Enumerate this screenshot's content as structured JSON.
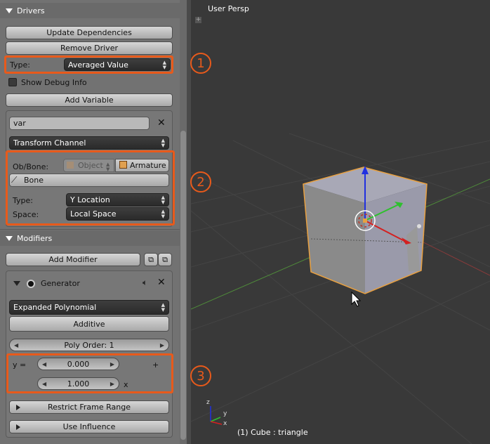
{
  "drivers": {
    "header": "Drivers",
    "update_dependencies": "Update Dependencies",
    "remove_driver": "Remove Driver",
    "type_label": "Type:",
    "type_value": "Averaged Value",
    "show_debug": "Show Debug Info",
    "add_variable": "Add Variable",
    "var_name": "var",
    "var_type": "Transform Channel",
    "ob_bone_label": "Ob/Bone:",
    "object_value": "Object",
    "armature_value": "Armature",
    "bone_value": "Bone",
    "channel_type_label": "Type:",
    "channel_type_value": "Y Location",
    "space_label": "Space:",
    "space_value": "Local Space"
  },
  "modifiers": {
    "header": "Modifiers",
    "add_modifier": "Add Modifier",
    "generator_name": "Generator",
    "mode": "Expanded Polynomial",
    "additive": "Additive",
    "poly_order": "Poly Order: 1",
    "y_equals": "y =",
    "coef0": "0.000",
    "plus": "+",
    "coef1": "1.000",
    "x_label": "x",
    "restrict_frame_range": "Restrict Frame Range",
    "use_influence": "Use Influence"
  },
  "annotations": [
    "1",
    "2",
    "3"
  ],
  "viewport": {
    "view_name": "User Persp",
    "object_info": "(1) Cube : triangle",
    "axis_x": "x",
    "axis_y": "y",
    "axis_z": "z"
  },
  "colors": {
    "highlight": "#e85a1b",
    "selection_outline": "#e8a040",
    "axis_red": "#d42020",
    "axis_green": "#2ec02e",
    "axis_blue": "#2030e0"
  }
}
